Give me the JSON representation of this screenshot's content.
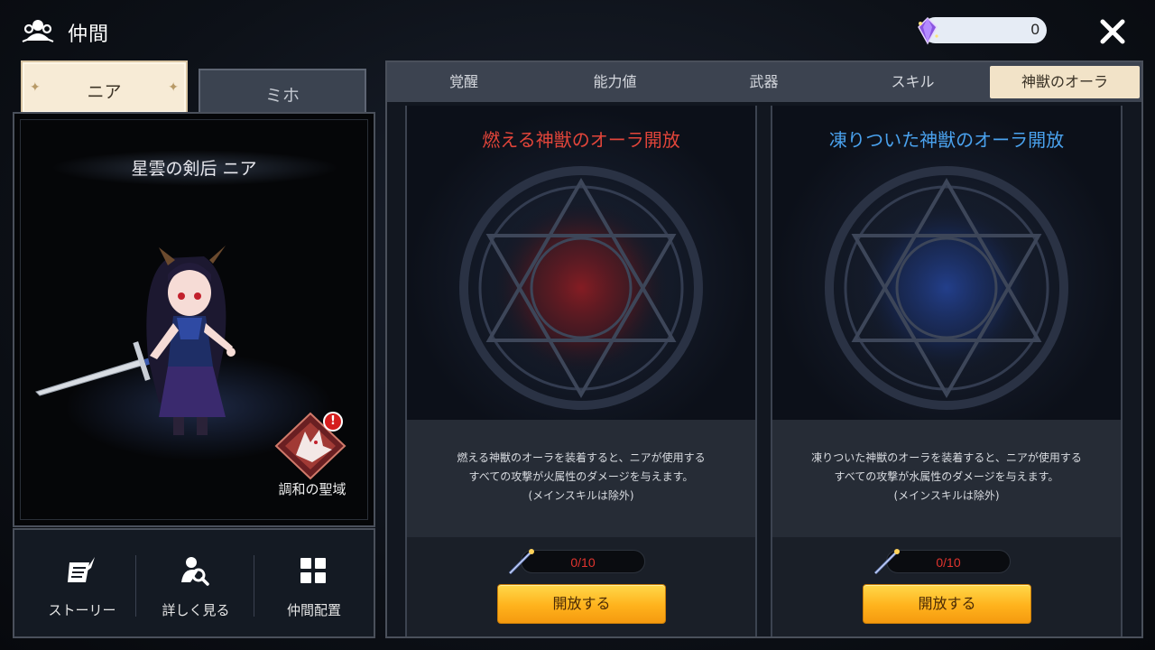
{
  "header": {
    "title": "仲間",
    "currency_value": "0"
  },
  "character_tabs": [
    {
      "label": "ニア",
      "active": true
    },
    {
      "label": "ミホ",
      "active": false
    }
  ],
  "character": {
    "name": "星雲の剣后 ニア",
    "sanctuary_label": "調和の聖域",
    "alert_badge": "!"
  },
  "actions": [
    {
      "label": "ストーリー",
      "icon": "quill-scroll-icon"
    },
    {
      "label": "詳しく見る",
      "icon": "inspect-person-icon"
    },
    {
      "label": "仲間配置",
      "icon": "grid-icon"
    }
  ],
  "tabs": [
    {
      "label": "覚醒",
      "active": false
    },
    {
      "label": "能力値",
      "active": false
    },
    {
      "label": "武器",
      "active": false
    },
    {
      "label": "スキル",
      "active": false
    },
    {
      "label": "神獣のオーラ",
      "active": true
    }
  ],
  "auras": [
    {
      "title": "燃える神獣のオーラ開放",
      "title_color": "#e2453a",
      "glow_color": "#8a1c22",
      "desc_line1": "燃える神獣のオーラを装着すると、ニアが使用する",
      "desc_line2": "すべての攻撃が火属性のダメージを与えます。",
      "desc_line3": "(メインスキルは除外)",
      "progress_text": "0/10",
      "button_label": "開放する"
    },
    {
      "title": "凍りついた神獣のオーラ開放",
      "title_color": "#4aa2ee",
      "glow_color": "#23408f",
      "desc_line1": "凍りついた神獣のオーラを装着すると、ニアが使用する",
      "desc_line2": "すべての攻撃が水属性のダメージを与えます。",
      "desc_line3": "(メインスキルは除外)",
      "progress_text": "0/10",
      "button_label": "開放する"
    }
  ],
  "colors": {
    "active_tab_bg": "#f2e3c8",
    "button_yellow": "#ffb21c",
    "progress_text": "#e0342e"
  }
}
